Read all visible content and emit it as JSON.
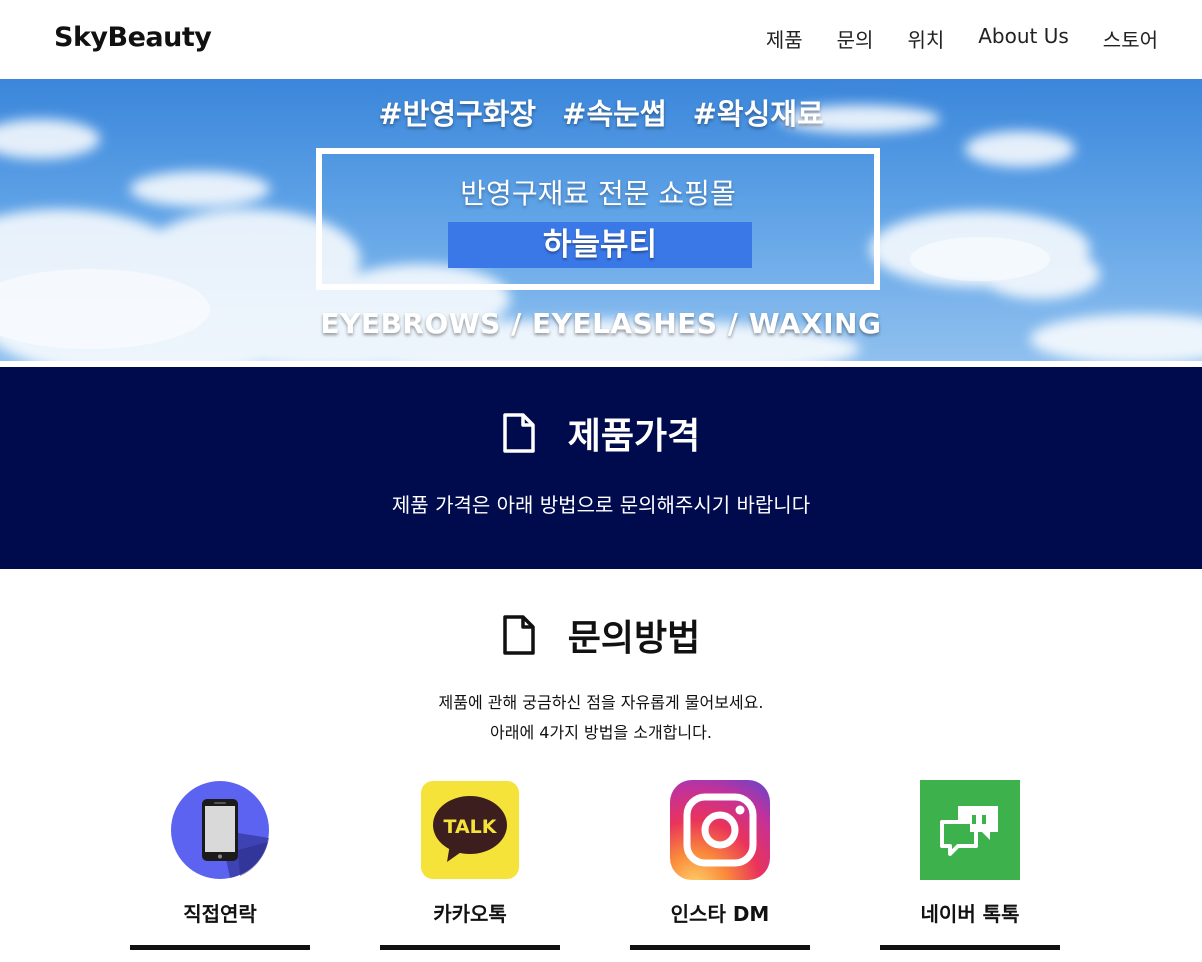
{
  "navbar": {
    "brand": "SkyBeauty",
    "links": [
      "제품",
      "문의",
      "위치",
      "About Us",
      "스토어"
    ]
  },
  "hero": {
    "tags": [
      "#반영구화장",
      "#속눈썹",
      "#왁싱재료"
    ],
    "subtitle": "반영구재료 전문 쇼핑몰",
    "brand_name": "하늘뷰티",
    "categories": "EYEBROWS / EYELASHES / WAXING"
  },
  "price_section": {
    "icon": "document-icon",
    "title": "제품가격",
    "description": "제품 가격은 아래 방법으로 문의해주시기 바랍니다"
  },
  "contact_section": {
    "icon": "document-icon",
    "title": "문의방법",
    "description_lines": [
      "제품에 관해 궁금하신 점을 자유롭게 물어보세요.",
      "아래에 4가지 방법을 소개합니다."
    ],
    "methods": [
      {
        "label": "직접연락",
        "icon": "phone-icon"
      },
      {
        "label": "카카오톡",
        "icon": "kakaotalk-icon",
        "icon_text": "TALK"
      },
      {
        "label": "인스타 DM",
        "icon": "instagram-icon"
      },
      {
        "label": "네이버 톡톡",
        "icon": "naver-talktalk-icon"
      }
    ]
  },
  "colors": {
    "price_bg": "#000b4d",
    "hero_brand_bg": "#3a78e8",
    "kakao_yellow": "#f5e33a",
    "naver_green": "#3db14b",
    "phone_circle": "#5b63f0"
  }
}
